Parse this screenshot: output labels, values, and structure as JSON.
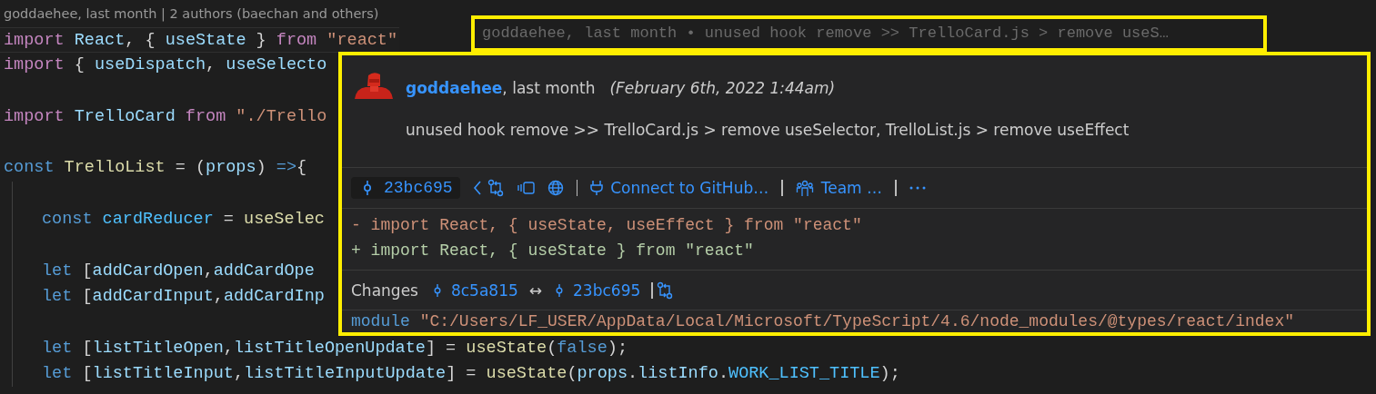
{
  "codelens": {
    "text": "goddaehee, last month | 2 authors (baechan and others)"
  },
  "editor": {
    "lines": [
      {
        "kind": "code",
        "indented": false,
        "current": true,
        "tokens": [
          {
            "kind": "keyword",
            "text": "import"
          },
          {
            "kind": "variable",
            "text": " React"
          },
          {
            "kind": "plain",
            "text": ", { "
          },
          {
            "kind": "variable",
            "text": "useState"
          },
          {
            "kind": "plain",
            "text": " } "
          },
          {
            "kind": "keyword",
            "text": "from"
          },
          {
            "kind": "string",
            "text": " \"react\""
          }
        ]
      },
      {
        "kind": "code",
        "indented": false,
        "current": false,
        "tokens": [
          {
            "kind": "keyword",
            "text": "import"
          },
          {
            "kind": "plain",
            "text": " { "
          },
          {
            "kind": "variable",
            "text": "useDispatch"
          },
          {
            "kind": "plain",
            "text": ", "
          },
          {
            "kind": "variable",
            "text": "useSelecto"
          }
        ]
      },
      {
        "kind": "blank",
        "indented": false,
        "current": false
      },
      {
        "kind": "code",
        "indented": false,
        "current": false,
        "tokens": [
          {
            "kind": "keyword",
            "text": "import"
          },
          {
            "kind": "variable",
            "text": " TrelloCard"
          },
          {
            "kind": "keyword",
            "text": " from"
          },
          {
            "kind": "string",
            "text": " \"./Trello"
          }
        ]
      },
      {
        "kind": "blank",
        "indented": false,
        "current": false
      },
      {
        "kind": "code",
        "indented": false,
        "current": false,
        "tokens": [
          {
            "kind": "storage",
            "text": "const"
          },
          {
            "kind": "function",
            "text": " TrelloList"
          },
          {
            "kind": "plain",
            "text": " = ("
          },
          {
            "kind": "variable",
            "text": "props"
          },
          {
            "kind": "plain",
            "text": ") "
          },
          {
            "kind": "storage",
            "text": "=>"
          },
          {
            "kind": "plain",
            "text": "{"
          }
        ]
      },
      {
        "kind": "blank",
        "indented": true,
        "current": false
      },
      {
        "kind": "code",
        "indented": true,
        "current": false,
        "tokens": [
          {
            "kind": "storage",
            "text": "const"
          },
          {
            "kind": "constant",
            "text": " cardReducer"
          },
          {
            "kind": "plain",
            "text": " = "
          },
          {
            "kind": "function",
            "text": "useSelec"
          }
        ]
      },
      {
        "kind": "blank",
        "indented": true,
        "current": false
      },
      {
        "kind": "code",
        "indented": true,
        "current": false,
        "tokens": [
          {
            "kind": "storage",
            "text": "let"
          },
          {
            "kind": "plain",
            "text": " ["
          },
          {
            "kind": "variable",
            "text": "addCardOpen"
          },
          {
            "kind": "plain",
            "text": ","
          },
          {
            "kind": "variable",
            "text": "addCardOpe"
          }
        ]
      },
      {
        "kind": "code",
        "indented": true,
        "current": false,
        "tokens": [
          {
            "kind": "storage",
            "text": "let"
          },
          {
            "kind": "plain",
            "text": " ["
          },
          {
            "kind": "variable",
            "text": "addCardInput"
          },
          {
            "kind": "plain",
            "text": ","
          },
          {
            "kind": "variable",
            "text": "addCardInp"
          }
        ]
      },
      {
        "kind": "blank",
        "indented": true,
        "current": false
      },
      {
        "kind": "code",
        "indented": true,
        "current": false,
        "tokens": [
          {
            "kind": "storage",
            "text": "let"
          },
          {
            "kind": "plain",
            "text": " ["
          },
          {
            "kind": "variable",
            "text": "listTitleOpen"
          },
          {
            "kind": "plain",
            "text": ","
          },
          {
            "kind": "variable",
            "text": "listTitleOpenUpdate"
          },
          {
            "kind": "plain",
            "text": "] = "
          },
          {
            "kind": "function",
            "text": "useState"
          },
          {
            "kind": "plain",
            "text": "("
          },
          {
            "kind": "storage",
            "text": "false"
          },
          {
            "kind": "plain",
            "text": ");"
          }
        ]
      },
      {
        "kind": "code",
        "indented": true,
        "current": false,
        "tokens": [
          {
            "kind": "storage",
            "text": "let"
          },
          {
            "kind": "plain",
            "text": " ["
          },
          {
            "kind": "variable",
            "text": "listTitleInput"
          },
          {
            "kind": "plain",
            "text": ","
          },
          {
            "kind": "variable",
            "text": "listTitleInputUpdate"
          },
          {
            "kind": "plain",
            "text": "] = "
          },
          {
            "kind": "function",
            "text": "useState"
          },
          {
            "kind": "plain",
            "text": "("
          },
          {
            "kind": "variable",
            "text": "props"
          },
          {
            "kind": "plain",
            "text": "."
          },
          {
            "kind": "variable",
            "text": "listInfo"
          },
          {
            "kind": "plain",
            "text": "."
          },
          {
            "kind": "constant",
            "text": "WORK_LIST_TITLE"
          },
          {
            "kind": "plain",
            "text": ");"
          }
        ]
      }
    ]
  },
  "inline_blame": {
    "text": "goddaehee, last month • unused hook remove >> TrelloCard.js > remove useS…"
  },
  "hover": {
    "author": "goddaehee",
    "when": ", last month",
    "date": "(February 6th, 2022 1:44am)",
    "message": "unused hook remove >> TrelloCard.js > remove useSelector, TrelloList.js > remove useEffect",
    "toolbar": {
      "sha": "23bc695",
      "github_link": "Connect to GitHub…",
      "team_link": "Team …"
    },
    "diff": [
      {
        "kind": "removed",
        "text": "- import React, { useState, useEffect } from \"react\""
      },
      {
        "kind": "added",
        "text": "+ import React, { useState } from \"react\""
      }
    ],
    "changes": {
      "label": "Changes",
      "from_sha": "8c5a815",
      "arrow": "↔",
      "to_sha": "23bc695"
    },
    "module": {
      "keyword": "module",
      "path": "\"C:/Users/LF_USER/AppData/Local/Microsoft/TypeScript/4.6/node_modules/@types/react/index\""
    }
  }
}
